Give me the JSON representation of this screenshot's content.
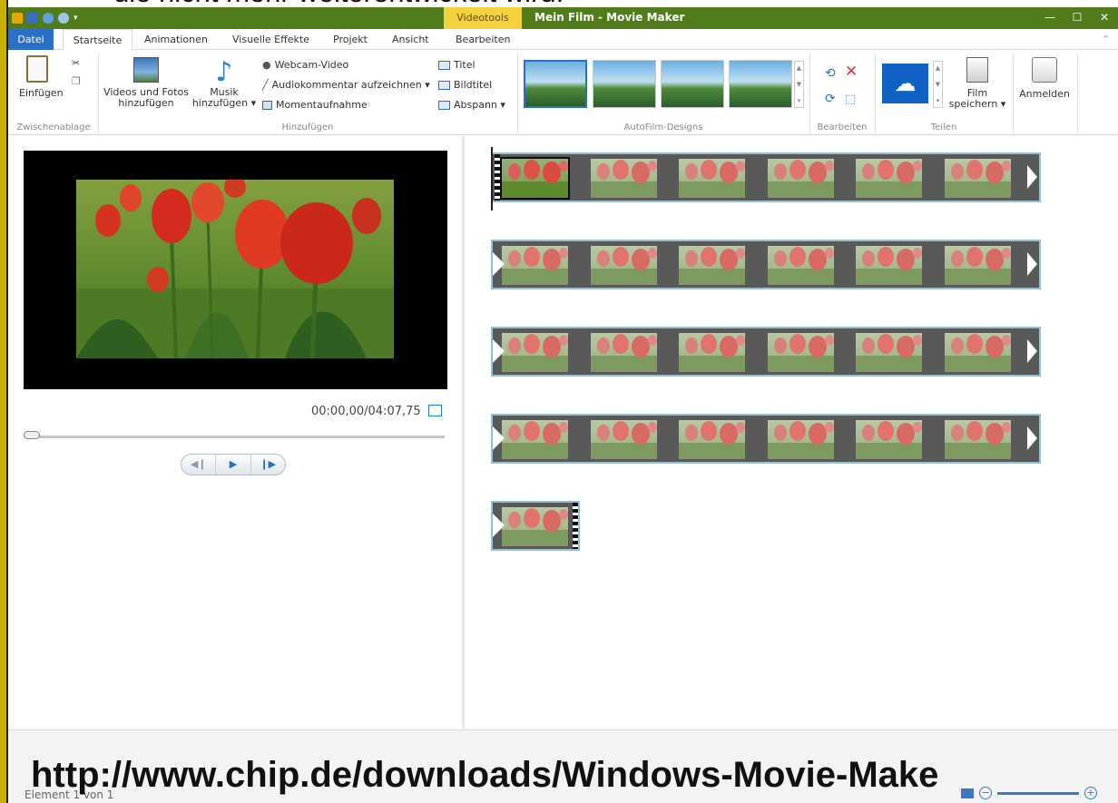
{
  "overlay": {
    "top_text": "die nicht mehr weiterentwickelt wird.",
    "bottom_url": "http://www.chip.de/downloads/Windows-Movie-Make"
  },
  "window": {
    "title": "Mein Film - Movie Maker",
    "context_group": "Videotools",
    "minimize": "—",
    "maximize": "☐",
    "close": "✕"
  },
  "tabs": [
    "Datei",
    "Startseite",
    "Animationen",
    "Visuelle Effekte",
    "Projekt",
    "Ansicht",
    "Bearbeiten"
  ],
  "ribbon": {
    "clipboard": {
      "paste": "Einfügen",
      "group": "Zwischenablage"
    },
    "add": {
      "videos_line1": "Videos und Fotos",
      "videos_line2": "hinzufügen",
      "music_line1": "Musik",
      "music_line2": "hinzufügen ▾",
      "webcam": "Webcam-Video",
      "narration": "Audiokommentar aufzeichnen ▾",
      "snapshot": "Momentaufnahme",
      "title": "Titel",
      "caption": "Bildtitel",
      "credits": "Abspann ▾",
      "group": "Hinzufügen"
    },
    "themes": {
      "group": "AutoFilm-Designs"
    },
    "edit": {
      "group": "Bearbeiten"
    },
    "share": {
      "save_line1": "Film",
      "save_line2": "speichern ▾",
      "group": "Teilen"
    },
    "signin": "Anmelden"
  },
  "preview": {
    "time": "00:00,00/04:07,75",
    "position": 0.0
  },
  "status": {
    "text": "Element 1 von 1"
  },
  "colors": {
    "titlebar": "#507d1a",
    "datei_tab": "#2b70c8",
    "context_tab": "#f3d23d",
    "clip_border": "#8fc1d8"
  }
}
